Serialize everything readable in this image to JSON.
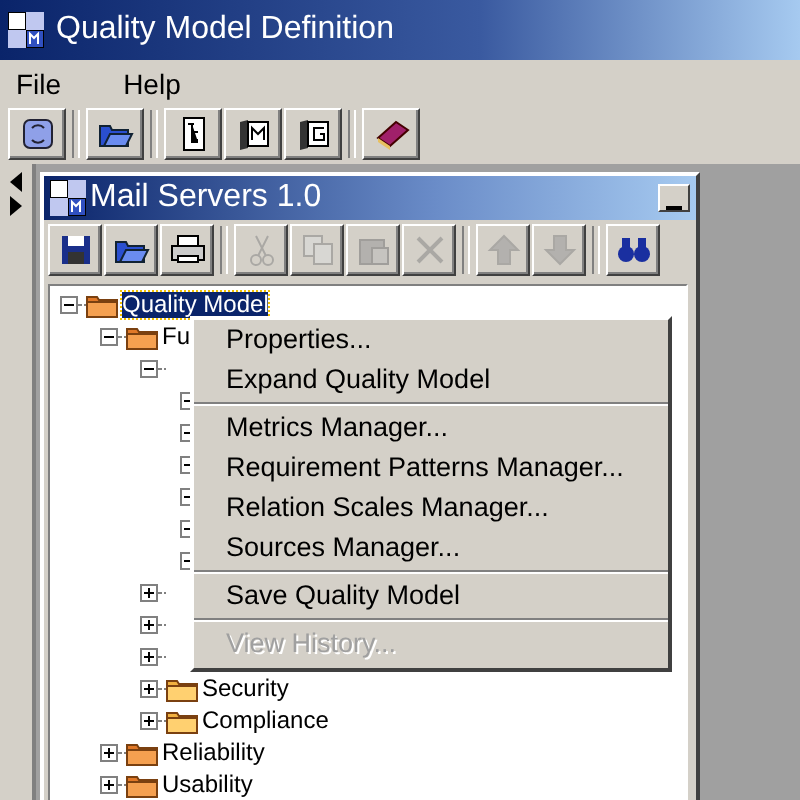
{
  "window": {
    "title": "Quality Model Definition"
  },
  "menu_bar": [
    {
      "label": "File"
    },
    {
      "label": "Help"
    }
  ],
  "toolbar": [
    {
      "kind": "refresh",
      "separator_before": false
    },
    {
      "kind": "open",
      "separator_before": true
    },
    {
      "kind": "tree",
      "separator_before": true
    },
    {
      "kind": "bookm",
      "separator_before": false
    },
    {
      "kind": "bookg",
      "separator_before": false
    },
    {
      "kind": "manual",
      "separator_before": true
    }
  ],
  "document": {
    "title": "Mail Servers 1.0",
    "toolbar": [
      {
        "kind": "save",
        "disabled": false,
        "separator_before": false
      },
      {
        "kind": "open",
        "disabled": false,
        "separator_before": false
      },
      {
        "kind": "print",
        "disabled": false,
        "separator_before": false
      },
      {
        "kind": "cut",
        "disabled": true,
        "separator_before": true
      },
      {
        "kind": "copy",
        "disabled": true,
        "separator_before": false
      },
      {
        "kind": "paste",
        "disabled": true,
        "separator_before": false
      },
      {
        "kind": "delete",
        "disabled": true,
        "separator_before": false
      },
      {
        "kind": "up",
        "disabled": true,
        "separator_before": true
      },
      {
        "kind": "down",
        "disabled": true,
        "separator_before": false
      },
      {
        "kind": "find",
        "disabled": false,
        "separator_before": true
      }
    ],
    "tree": [
      {
        "label": "Quality Model",
        "selected": true,
        "expanded": true,
        "children": [
          {
            "label": "Fu",
            "selected": false,
            "expanded": true,
            "children": [
              {
                "expanded": true,
                "children": [
                  {
                    "expanded": true
                  },
                  {
                    "expanded": true
                  },
                  {
                    "expanded": true
                  },
                  {
                    "expanded": true
                  },
                  {
                    "expanded": true
                  },
                  {
                    "expanded": true
                  }
                ]
              },
              {
                "expanded": false
              },
              {
                "expanded": false
              },
              {
                "expanded": false
              },
              {
                "label": "Security",
                "selected": false,
                "expanded": false
              },
              {
                "label": "Compliance",
                "selected": false,
                "expanded": false
              }
            ]
          },
          {
            "label": "Reliability",
            "selected": false,
            "expanded": false
          },
          {
            "label": "Usability",
            "selected": false,
            "expanded": false
          }
        ]
      }
    ]
  },
  "context_menu": [
    {
      "label": "Properties...",
      "disabled": false,
      "separator_before": false
    },
    {
      "label": "Expand Quality Model",
      "disabled": false,
      "separator_before": false
    },
    {
      "label": "Metrics Manager...",
      "disabled": false,
      "separator_before": true
    },
    {
      "label": "Requirement Patterns Manager...",
      "disabled": false,
      "separator_before": false
    },
    {
      "label": "Relation Scales Manager...",
      "disabled": false,
      "separator_before": false
    },
    {
      "label": "Sources Manager...",
      "disabled": false,
      "separator_before": false
    },
    {
      "label": "Save Quality Model",
      "disabled": false,
      "separator_before": true
    },
    {
      "label": "View History...",
      "disabled": true,
      "separator_before": true
    }
  ]
}
